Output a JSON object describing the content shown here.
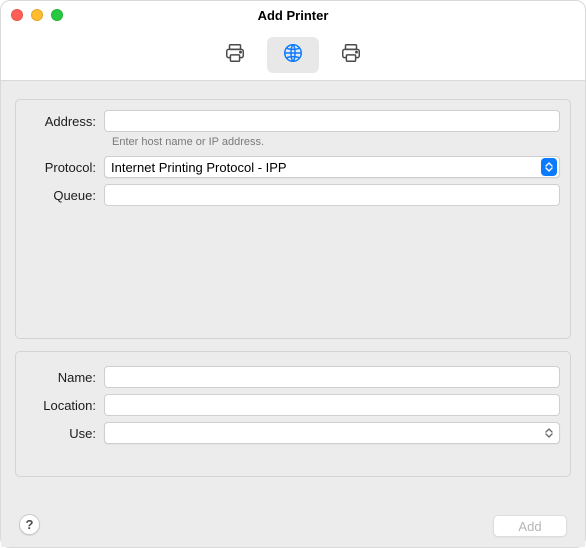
{
  "window": {
    "title": "Add Printer"
  },
  "toolbar": {
    "tabs": [
      {
        "id": "default",
        "selected": false
      },
      {
        "id": "ip",
        "selected": true
      },
      {
        "id": "windows",
        "selected": false
      }
    ]
  },
  "form": {
    "address": {
      "label": "Address:",
      "value": "",
      "hint": "Enter host name or IP address."
    },
    "protocol": {
      "label": "Protocol:",
      "value": "Internet Printing Protocol - IPP"
    },
    "queue": {
      "label": "Queue:",
      "value": ""
    },
    "name": {
      "label": "Name:",
      "value": ""
    },
    "location": {
      "label": "Location:",
      "value": ""
    },
    "use": {
      "label": "Use:",
      "value": ""
    }
  },
  "buttons": {
    "help": "?",
    "add": "Add"
  },
  "colors": {
    "accent": "#0a7aff"
  }
}
